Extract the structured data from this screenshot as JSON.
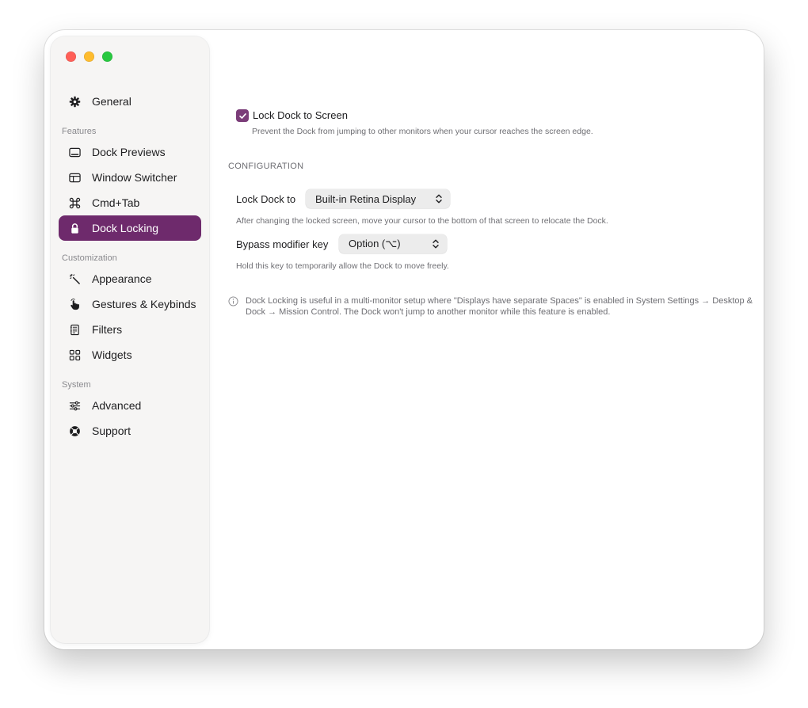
{
  "window": {
    "traffic_lights": [
      "close",
      "minimize",
      "zoom"
    ]
  },
  "sidebar": {
    "general": {
      "label": "General",
      "icon": "gear-icon"
    },
    "sections": [
      {
        "label": "Features",
        "items": [
          {
            "label": "Dock Previews",
            "icon": "dock-icon"
          },
          {
            "label": "Window Switcher",
            "icon": "window-layout-icon"
          },
          {
            "label": "Cmd+Tab",
            "icon": "command-icon"
          },
          {
            "label": "Dock Locking",
            "icon": "lock-icon",
            "active": true
          }
        ]
      },
      {
        "label": "Customization",
        "items": [
          {
            "label": "Appearance",
            "icon": "magic-wand-icon"
          },
          {
            "label": "Gestures & Keybinds",
            "icon": "hand-pointer-icon"
          },
          {
            "label": "Filters",
            "icon": "filter-doc-icon"
          },
          {
            "label": "Widgets",
            "icon": "widgets-grid-icon"
          }
        ]
      },
      {
        "label": "System",
        "items": [
          {
            "label": "Advanced",
            "icon": "sliders-icon"
          },
          {
            "label": "Support",
            "icon": "lifebuoy-icon"
          }
        ]
      }
    ],
    "accent_color": "#6e2a6c"
  },
  "main": {
    "lock_checkbox": {
      "label": "Lock Dock to Screen",
      "checked": true,
      "description": "Prevent the Dock from jumping to other monitors when your cursor reaches the screen edge."
    },
    "configuration_heading": "CONFIGURATION",
    "lock_dock_to": {
      "label": "Lock Dock to",
      "value": "Built-in Retina Display",
      "description": "After changing the locked screen, move your cursor to the bottom of that screen to relocate the Dock."
    },
    "bypass_modifier": {
      "label": "Bypass modifier key",
      "value": "Option (⌥)",
      "description": "Hold this key to temporarily allow the Dock to move freely."
    },
    "info": "Dock Locking is useful in a multi-monitor setup where \"Displays have separate Spaces\" is enabled in System Settings → Desktop & Dock → Mission Control. The Dock won't jump to another monitor while this feature is enabled."
  }
}
